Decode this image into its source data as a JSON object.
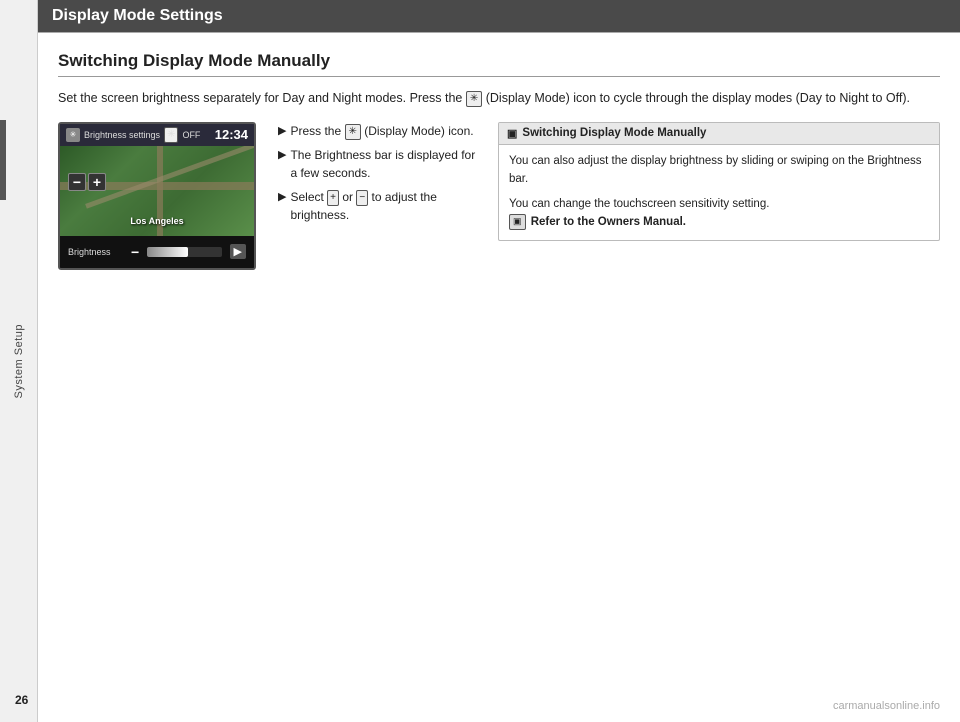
{
  "sidebar": {
    "label": "System Setup"
  },
  "header": {
    "title": "Display Mode Settings"
  },
  "section": {
    "title": "Switching Display Mode Manually"
  },
  "body_text": "Set the screen brightness separately for Day and Night modes. Press the  (Display Mode) icon to cycle through the display modes (Day to Night to Off).",
  "screen": {
    "top_label": "Brightness settings",
    "off_label": "OFF",
    "time": "12:34",
    "city_label": "Los Angeles",
    "minus": "−",
    "plus": "+",
    "brightness_label": "Brightness",
    "brightness_pct": 55
  },
  "steps": [
    {
      "text": "Press the  (Display Mode) icon."
    },
    {
      "text": "The Brightness bar is displayed for a few seconds."
    },
    {
      "text": "Select  or  to adjust the brightness."
    }
  ],
  "note": {
    "header": "Switching Display Mode Manually",
    "body_1": "You can also adjust the display brightness by sliding or swiping on the Brightness bar.",
    "body_2": "You can change the touchscreen sensitivity setting.",
    "ref_text": "Refer to the Owners Manual."
  },
  "page_number": "26",
  "watermark": "carmanualsonline.info"
}
